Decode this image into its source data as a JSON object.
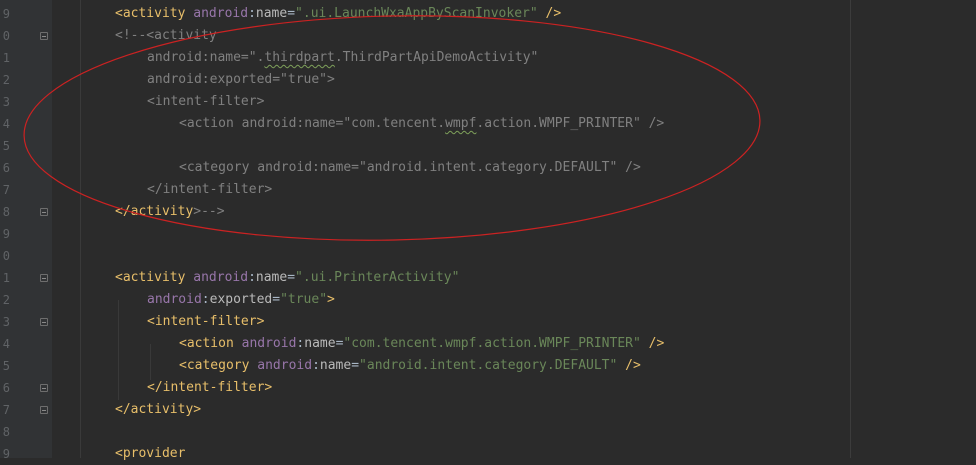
{
  "gutter": {
    "line_numbers": [
      "9",
      "0",
      "1",
      "2",
      "3",
      "4",
      "5",
      "6",
      "7",
      "8",
      "9",
      "0",
      "1",
      "2",
      "3",
      "4",
      "5",
      "6",
      "7",
      "8",
      "9"
    ]
  },
  "code": {
    "l1": {
      "open": "<activity",
      "ns": "android",
      "colon": ":",
      "attr": "name",
      "eq": "=",
      "val": "\".ui.LaunchWxaAppByScanInvoker\"",
      "close": " />"
    },
    "l2": {
      "text": "<!--<activity"
    },
    "l3": {
      "a": "android:name=\".",
      "b": "thirdpart",
      "c": ".ThirdPartApiDemoActivity\""
    },
    "l4": {
      "text": "android:exported=\"true\">"
    },
    "l5": {
      "text": "<intent-filter>"
    },
    "l6": {
      "a": "<action android:name=\"com.tencent.",
      "b": "wmpf",
      "c": ".action.WMPF_PRINTER\" />"
    },
    "l8": {
      "text": "<category android:name=\"android.intent.category.DEFAULT\" />"
    },
    "l9": {
      "text": "</intent-filter>"
    },
    "l10": {
      "a": "</activity",
      "b": ">-->"
    },
    "l13": {
      "open": "<activity",
      "ns": "android",
      "colon": ":",
      "attr": "name",
      "eq": "=",
      "val": "\".ui.PrinterActivity\""
    },
    "l14": {
      "ns": "android",
      "colon": ":",
      "attr": "exported",
      "eq": "=",
      "val": "\"true\"",
      "close": ">"
    },
    "l15": {
      "text": "<intent-filter>"
    },
    "l16": {
      "open": "<action",
      "ns": "android",
      "colon": ":",
      "attr": "name",
      "eq": "=",
      "val": "\"com.tencent.wmpf.action.WMPF_PRINTER\"",
      "close": " />"
    },
    "l17": {
      "open": "<category",
      "ns": "android",
      "colon": ":",
      "attr": "name",
      "eq": "=",
      "val": "\"android.intent.category.DEFAULT\"",
      "close": " />"
    },
    "l18": {
      "text": "</intent-filter>"
    },
    "l19": {
      "text": "</activity>"
    },
    "l21": {
      "text": "<provider"
    }
  },
  "annotation": {
    "color": "#cc2222",
    "shape": "ellipse"
  }
}
